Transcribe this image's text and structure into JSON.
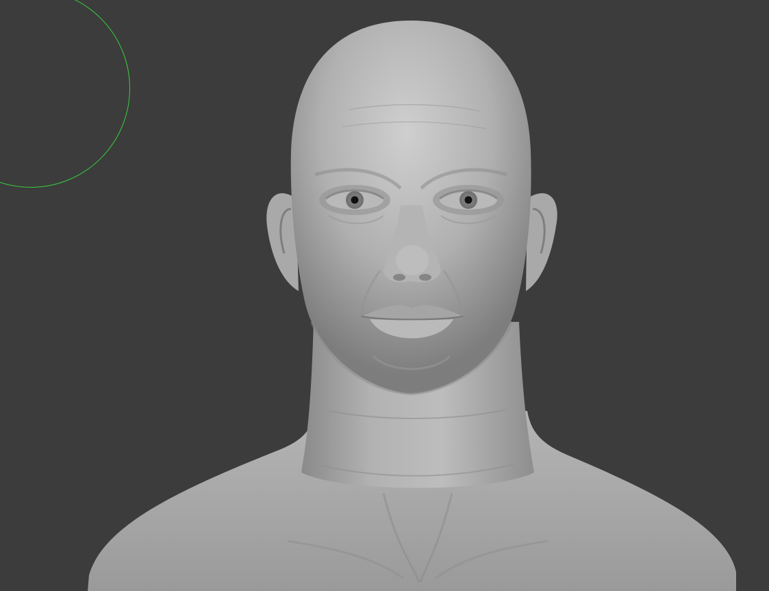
{
  "viewport": {
    "background_color": "#3c3c3c"
  },
  "brush_cursor": {
    "color": "#36d13c",
    "icon": "circle-brush-cursor"
  },
  "model": {
    "object": "sculpted-male-head-bust",
    "material_color": "#b8b8b8",
    "eye_color": "#111111"
  }
}
